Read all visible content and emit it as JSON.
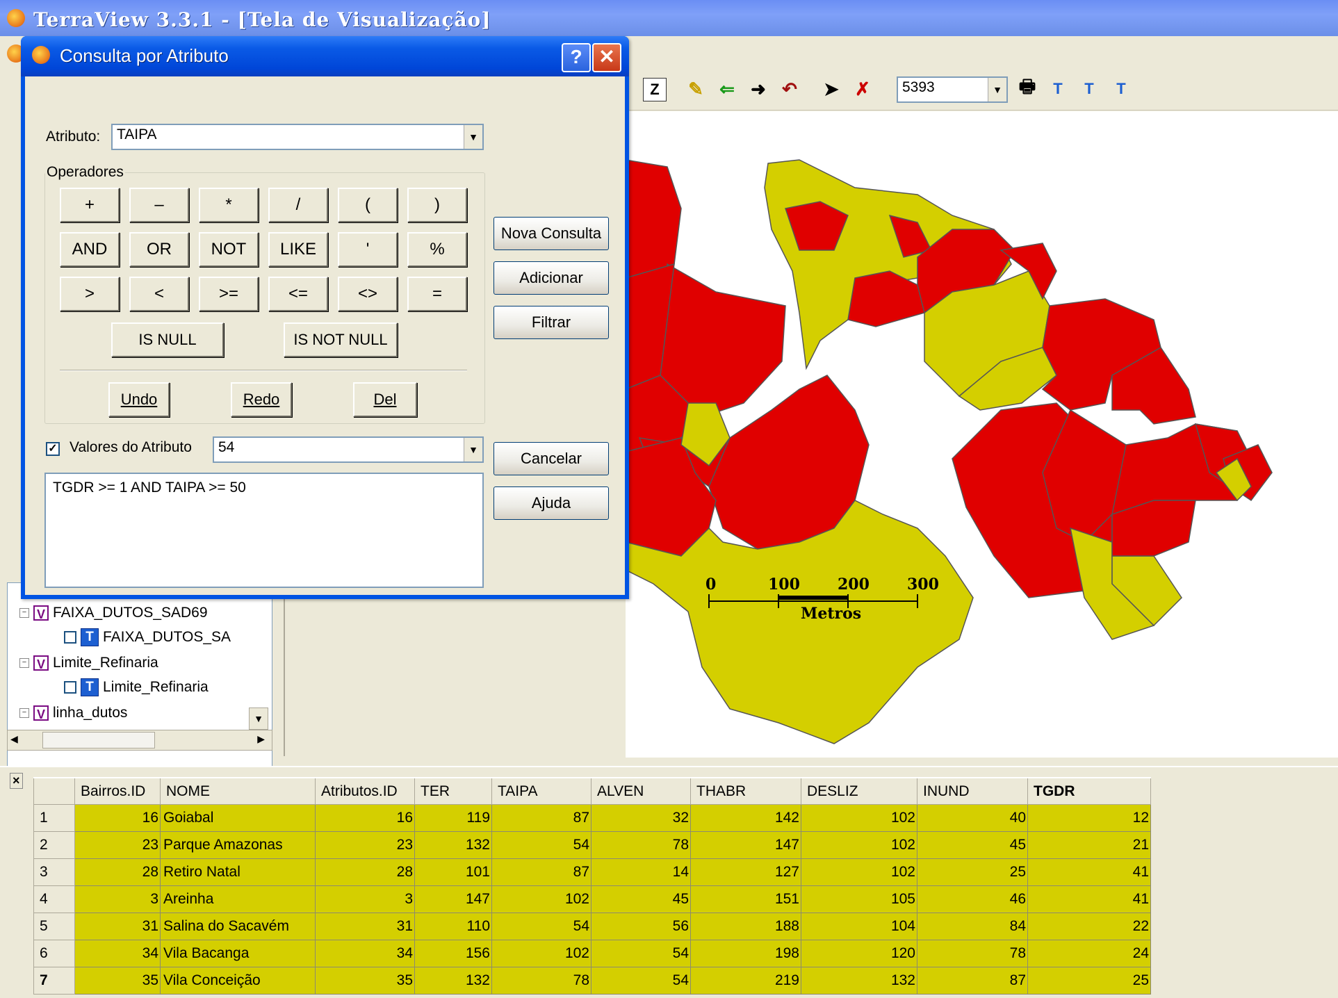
{
  "app": {
    "title": "TerraView 3.3.1 - [Tela de Visualização]"
  },
  "toolbar": {
    "scale_value": "5393"
  },
  "dialog": {
    "title": "Consulta por Atributo",
    "attribute_label": "Atributo:",
    "attribute_value": "TAIPA",
    "operators_legend": "Operadores",
    "op_row1": [
      "+",
      "–",
      "*",
      "/",
      "(",
      ")"
    ],
    "op_row2": [
      "AND",
      "OR",
      "NOT",
      "LIKE",
      "'",
      "%"
    ],
    "op_row3": [
      ">",
      "<",
      ">=",
      "<=",
      "<>",
      "="
    ],
    "is_null": "IS NULL",
    "is_not_null": "IS NOT NULL",
    "undo": "Undo",
    "redo": "Redo",
    "del": "Del",
    "nova_consulta": "Nova Consulta",
    "adicionar": "Adicionar",
    "filtrar": "Filtrar",
    "cancelar": "Cancelar",
    "ajuda": "Ajuda",
    "values_label": "Valores do Atributo",
    "values_checked": true,
    "values_value": "54",
    "query_text": "TGDR >= 1 AND TAIPA >= 50"
  },
  "tree": {
    "items": [
      {
        "kind": "V",
        "label": "FAIXA_DUTOS_SAD69"
      },
      {
        "kind": "T",
        "label": "FAIXA_DUTOS_SA"
      },
      {
        "kind": "V",
        "label": "Limite_Refinaria"
      },
      {
        "kind": "T",
        "label": "Limite_Refinaria"
      },
      {
        "kind": "V",
        "label": "linha_dutos"
      }
    ]
  },
  "scalebar": {
    "ticks": [
      "0",
      "100",
      "200",
      "300"
    ],
    "unit": "Metros"
  },
  "colors": {
    "red": "#e00000",
    "yellow": "#d4cf00"
  },
  "table": {
    "columns": [
      "Bairros.ID",
      "NOME",
      "Atributos.ID",
      "TER",
      "TAIPA",
      "ALVEN",
      "THABR",
      "DESLIZ",
      "INUND",
      "TGDR"
    ],
    "rows": [
      {
        "n": "1",
        "cells": [
          "16",
          "Goiabal",
          "16",
          "119",
          "87",
          "32",
          "142",
          "102",
          "40",
          "12"
        ]
      },
      {
        "n": "2",
        "cells": [
          "23",
          "Parque Amazonas",
          "23",
          "132",
          "54",
          "78",
          "147",
          "102",
          "45",
          "21"
        ]
      },
      {
        "n": "3",
        "cells": [
          "28",
          "Retiro Natal",
          "28",
          "101",
          "87",
          "14",
          "127",
          "102",
          "25",
          "41"
        ]
      },
      {
        "n": "4",
        "cells": [
          "3",
          "Areinha",
          "3",
          "147",
          "102",
          "45",
          "151",
          "105",
          "46",
          "41"
        ]
      },
      {
        "n": "5",
        "cells": [
          "31",
          "Salina do Sacavém",
          "31",
          "110",
          "54",
          "56",
          "188",
          "104",
          "84",
          "22"
        ]
      },
      {
        "n": "6",
        "cells": [
          "34",
          "Vila Bacanga",
          "34",
          "156",
          "102",
          "54",
          "198",
          "120",
          "78",
          "24"
        ]
      },
      {
        "n": "7",
        "cells": [
          "35",
          "Vila Conceição",
          "35",
          "132",
          "78",
          "54",
          "219",
          "132",
          "87",
          "25"
        ]
      }
    ]
  }
}
